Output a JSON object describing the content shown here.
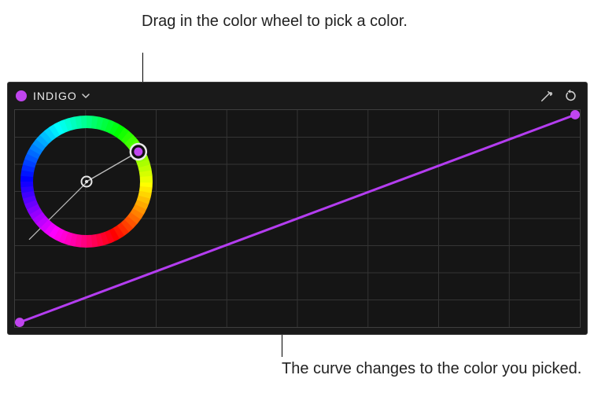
{
  "annotations": {
    "top": "Drag in the color wheel to pick a color.",
    "bottom": "The curve changes to the color you picked."
  },
  "panel": {
    "dropdown_label": "INDIGO",
    "swatch_color": "#c045ef",
    "curve_color": "#b43df0",
    "anchor_fill_color": "#c045ef",
    "icons": {
      "eyedropper": "eyedropper-icon",
      "reset": "reset-icon"
    }
  },
  "color_wheel": {
    "picker_angle_deg": 30,
    "picker_fill": "#c045ef"
  }
}
